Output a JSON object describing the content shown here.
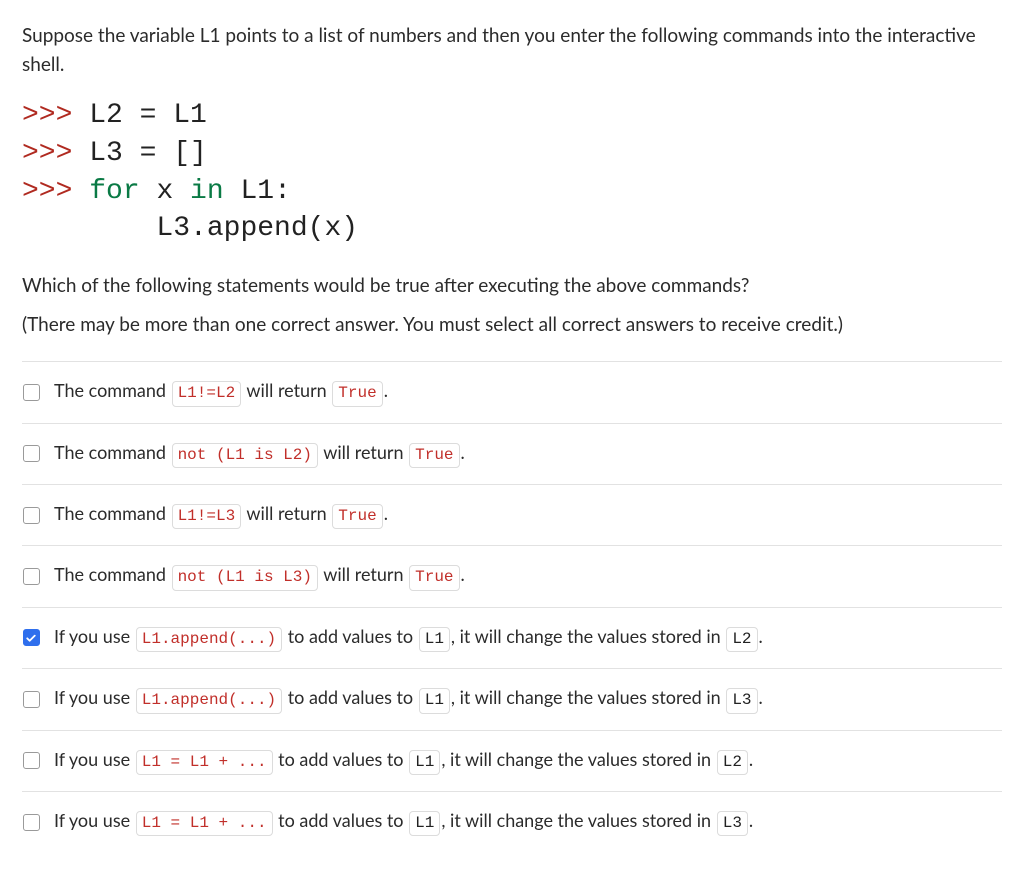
{
  "intro": "Suppose the variable L1 points to a list of numbers and then you enter the following commands into the interactive shell.",
  "code": {
    "prompt": ">>>",
    "line1_a": " L2 ",
    "line1_op": "=",
    "line1_b": " L1",
    "line2_a": " L3 ",
    "line2_op": "=",
    "line2_b": " []",
    "line3_for": " for",
    "line3_x": " x",
    "line3_in": " in",
    "line3_L1": " L1",
    "line3_colon": ":",
    "line4_indent": "        L3",
    "line4_dot": ".",
    "line4_append": "append",
    "line4_paren": "(x)"
  },
  "q2": "Which of the following statements would be true after executing the above commands?",
  "q3": "(There may be more than one correct answer. You must select all correct answers to receive credit.)",
  "txt": {
    "the_command": "The command ",
    "will_return": " will return ",
    "period": ".",
    "if_you_use": "If you use ",
    "to_add_values_to": " to add values to ",
    "comma_change": ", it will change the values stored in "
  },
  "chips": {
    "l1_ne_l2": "L1!=L2",
    "l1_ne_l3": "L1!=L3",
    "not_l1_is_l2": "not (L1 is L2)",
    "not_l1_is_l3": "not (L1 is L3)",
    "True": "True",
    "l1_append": "L1.append(...)",
    "l1_eq_l1_plus": "L1 = L1 + ...",
    "L1": "L1",
    "L2": "L2",
    "L3": "L3"
  },
  "options_checked": [
    false,
    false,
    false,
    false,
    true,
    false,
    false,
    false
  ]
}
